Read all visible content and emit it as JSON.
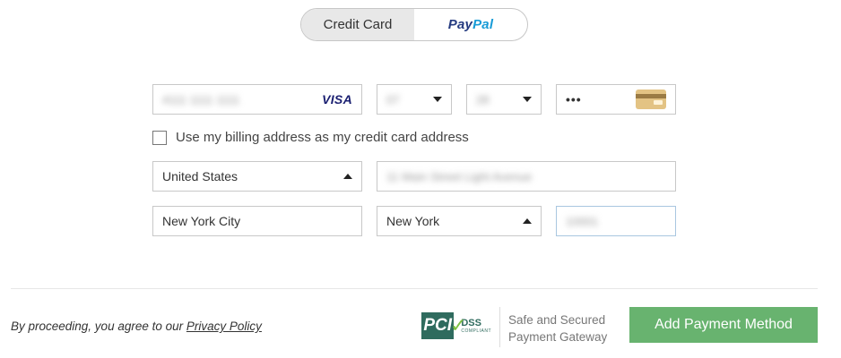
{
  "payment_toggle": {
    "credit_card_label": "Credit Card",
    "paypal_pay": "Pay",
    "paypal_pal": "Pal",
    "active": "Credit Card"
  },
  "card": {
    "number_value": "4111 1111 1111",
    "brand": "VISA",
    "month_value": "07",
    "year_value": "28",
    "cvv_value": "•••"
  },
  "billing_checkbox": {
    "label": "Use my billing address as my credit card address",
    "checked": false
  },
  "address": {
    "country_value": "United States",
    "street_value": "11 Main Street Light Avenue",
    "city_value": "New York City",
    "state_value": "New York",
    "zip_value": "10001"
  },
  "footer": {
    "terms_prefix": "By proceeding, you agree to our ",
    "privacy_link": "Privacy Policy",
    "pci_text": "PCI",
    "dss_text": "DSS",
    "compliant_text": "COMPLIANT",
    "secure_line1": "Safe and Secured",
    "secure_line2": "Payment Gateway",
    "submit_label": "Add Payment Method"
  },
  "colors": {
    "submit_bg": "#68b36f",
    "toggle_active_bg": "#e8e8e8",
    "paypal_dark": "#253b80",
    "paypal_light": "#179bd7"
  }
}
